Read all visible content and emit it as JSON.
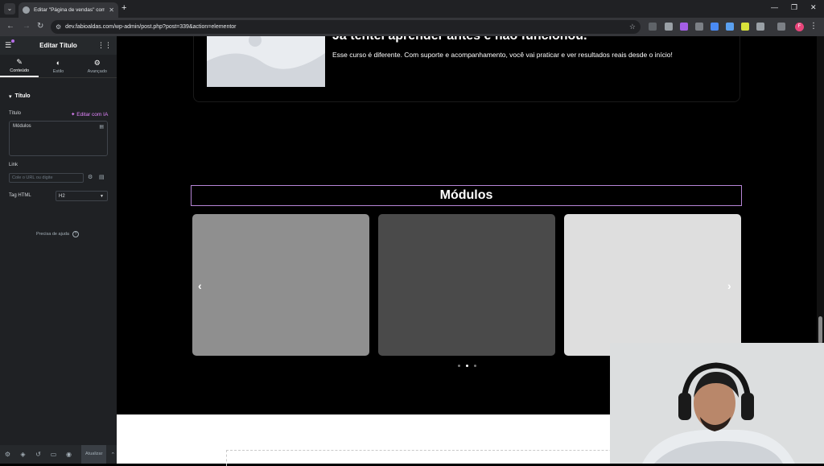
{
  "browser": {
    "tab_title": "Editar \"Página de vendas\" com",
    "url": "dev.fabioaldas.com/wp-admin/post.php?post=339&action=elementor"
  },
  "panel": {
    "header_title": "Editar Título",
    "tabs": [
      {
        "label": "Conteúdo",
        "icon": "pencil-icon"
      },
      {
        "label": "Estilo",
        "icon": "half-circle-icon"
      },
      {
        "label": "Avançado",
        "icon": "gear-icon"
      }
    ],
    "section_title": "Título",
    "title_label": "Título",
    "ai_link": "Editar com IA",
    "title_value": "Módulos",
    "link_label": "Link",
    "link_placeholder": "Cole o URL ou digite",
    "tag_label": "Tag HTML",
    "tag_value": "H2",
    "help_text": "Precisa de ajuda",
    "publish_label": "Atualizar"
  },
  "canvas": {
    "card_title": "Já tentei aprender antes e não funcionou.",
    "card_text": "Esse curso é diferente. Com suporte e acompanhamento, você vai praticar e ver resultados reais desde o início!",
    "heading": "Módulos",
    "slides": [
      {
        "color": "#8f8f8f"
      },
      {
        "color": "#4a4a4a"
      },
      {
        "color": "#dedede"
      }
    ],
    "active_dot": 1
  },
  "colors": {
    "panel_bg": "#1f2124",
    "accent": "#e486ff",
    "heading_border": "#b685d6"
  }
}
